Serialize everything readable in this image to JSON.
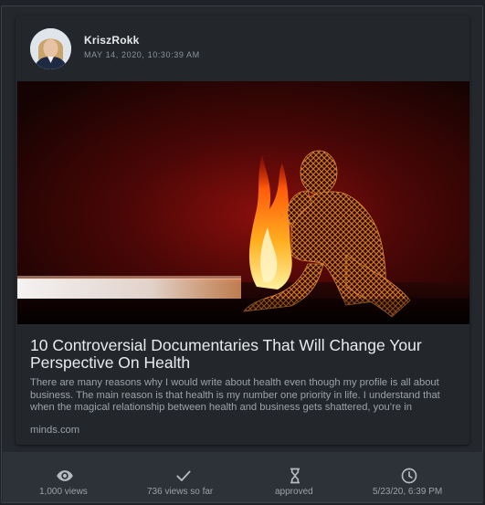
{
  "post": {
    "author": "KriszRokk",
    "timestamp": "MAY 14, 2020, 10:30:39 AM",
    "title": "10 Controversial Documentaries That Will Change Your Perspective On Health",
    "excerpt": "There are many reasons why I would write about health even though my profile is all about business. The main reason is that health is my number one priority in life. I understand that when the magical relationship between health and business gets shattered, you’re in",
    "source": "minds.com"
  },
  "stats": [
    {
      "icon": "eye-icon",
      "label": "1,000 views"
    },
    {
      "icon": "check-icon",
      "label": "736 views so far"
    },
    {
      "icon": "hourglass-icon",
      "label": "approved"
    },
    {
      "icon": "clock-icon",
      "label": "5/23/20, 6:39 PM"
    }
  ],
  "colors": {
    "background": "#1f2327",
    "card": "#23272b",
    "stats_bar": "#2c3238",
    "text_primary": "#e9ebed",
    "text_secondary": "#9ba2a8"
  }
}
